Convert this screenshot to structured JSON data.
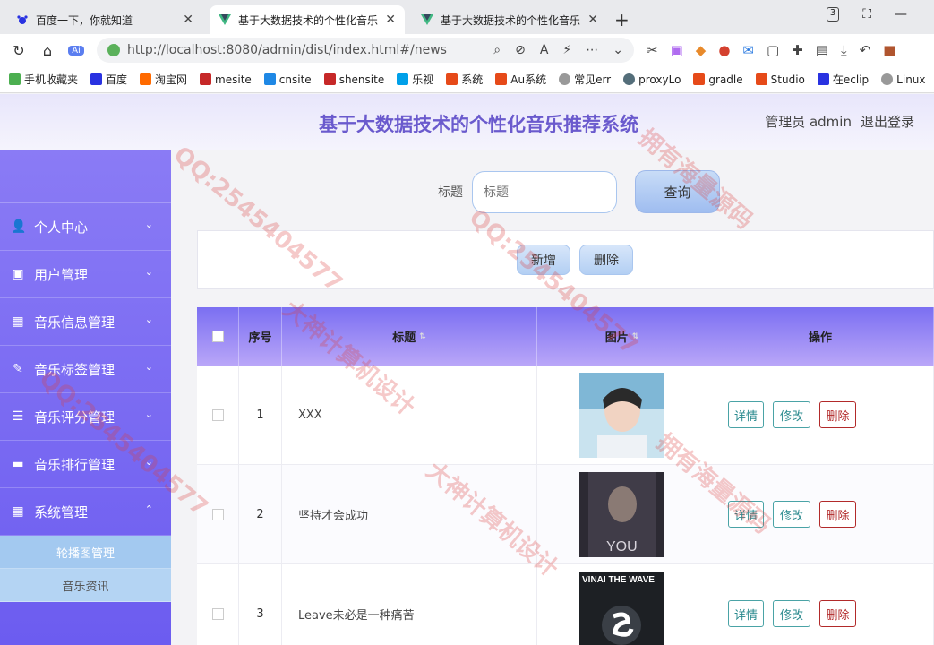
{
  "browser": {
    "tabs": [
      {
        "title": "百度一下，你就知道",
        "icon": "baidu-paw-icon",
        "active": false
      },
      {
        "title": "基于大数据技术的个性化音乐",
        "icon": "vue-logo-icon",
        "active": true
      },
      {
        "title": "基于大数据技术的个性化音乐",
        "icon": "vue-logo-icon",
        "active": false
      }
    ],
    "new_tab": "+",
    "tab_count_badge": "3",
    "url": "http://localhost:8080/admin/dist/index.html#/news",
    "bookmarks": [
      "手机收藏夹",
      "百度",
      "淘宝网",
      "mesite",
      "cnsite",
      "shensite",
      "乐视",
      "系统",
      "Au系统",
      "常见err",
      "proxyLo",
      "gradle",
      "Studio",
      "在eclip",
      "Linux"
    ]
  },
  "header": {
    "title": "基于大数据技术的个性化音乐推荐系统",
    "user_label": "管理员 admin",
    "logout": "退出登录"
  },
  "sidebar": {
    "items": [
      {
        "label": "个人中心",
        "icon": "user-icon"
      },
      {
        "label": "用户管理",
        "icon": "book-icon"
      },
      {
        "label": "音乐信息管理",
        "icon": "grid-icon"
      },
      {
        "label": "音乐标签管理",
        "icon": "tag-icon"
      },
      {
        "label": "音乐评分管理",
        "icon": "sliders-icon"
      },
      {
        "label": "音乐排行管理",
        "icon": "briefcase-icon"
      },
      {
        "label": "系统管理",
        "icon": "grid-icon"
      }
    ],
    "submenu": [
      "轮播图管理",
      "音乐资讯"
    ]
  },
  "search": {
    "label": "标题",
    "placeholder": "标题",
    "button": "查询"
  },
  "actions": {
    "add": "新增",
    "delete": "删除"
  },
  "table": {
    "headers": [
      "",
      "序号",
      "标题",
      "图片",
      "操作"
    ],
    "rows": [
      {
        "idx": "1",
        "title": "XXX",
        "image": "portrait-photo"
      },
      {
        "idx": "2",
        "title": "坚持才会成功",
        "image": "album-cover-you"
      },
      {
        "idx": "3",
        "title": "Leave未必是一种痛苦",
        "image": "album-cover-vinai"
      }
    ],
    "row_buttons": {
      "detail": "详情",
      "edit": "修改",
      "delete": "删除"
    }
  },
  "album_text": {
    "you_cover": "YOU",
    "vinai_cover": "VINAI THE WAVE"
  },
  "watermark": {
    "qq": "QQ:2545404577",
    "a": "大神计算机设计",
    "b": "拥有海量源码"
  },
  "colors": {
    "accent": "#6a5acd",
    "sidebar": "#7b6ff2",
    "teal_button": "#2a8a8e",
    "danger": "#b22a2a"
  }
}
